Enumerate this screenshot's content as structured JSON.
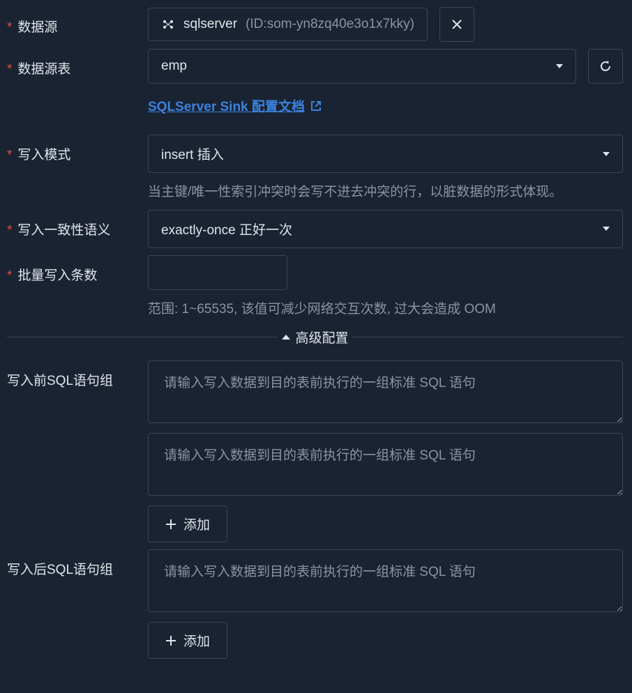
{
  "fields": {
    "datasource": {
      "label": "数据源",
      "value": "sqlserver",
      "id_prefix": "ID:",
      "id_value": "som-yn8zq40e3o1x7kky"
    },
    "table": {
      "label": "数据源表",
      "value": "emp"
    },
    "doc_link": "SQLServer Sink 配置文档",
    "write_mode": {
      "label": "写入模式",
      "value": "insert 插入",
      "help": "当主键/唯一性索引冲突时会写不进去冲突的行，以脏数据的形式体现。"
    },
    "consistency": {
      "label": "写入一致性语义",
      "value": "exactly-once 正好一次"
    },
    "batch_count": {
      "label": "批量写入条数",
      "value": "",
      "help": "范围: 1~65535, 该值可减少网络交互次数, 过大会造成 OOM"
    },
    "advanced_header": "高级配置",
    "pre_sql": {
      "label": "写入前SQL语句组",
      "placeholder1": "请输入写入数据到目的表前执行的一组标准 SQL 语句",
      "placeholder2": "请输入写入数据到目的表前执行的一组标准 SQL 语句",
      "add": "添加"
    },
    "post_sql": {
      "label": "写入后SQL语句组",
      "placeholder1": "请输入写入数据到目的表前执行的一组标准 SQL 语句",
      "add": "添加"
    }
  }
}
